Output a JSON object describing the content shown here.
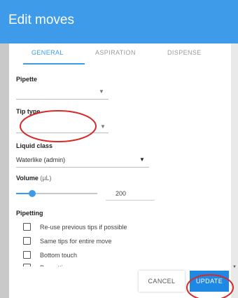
{
  "dialog": {
    "title": "Edit moves"
  },
  "tabs": [
    {
      "label": "GENERAL",
      "active": true
    },
    {
      "label": "ASPIRATION",
      "active": false
    },
    {
      "label": "DISPENSE",
      "active": false
    }
  ],
  "fields": {
    "pipette": {
      "label": "Pipette",
      "value": ""
    },
    "tip_type": {
      "label": "Tip type",
      "value": ""
    },
    "liquid_class": {
      "label": "Liquid class",
      "value": "Waterlike (admin)"
    },
    "volume": {
      "label": "Volume",
      "unit": "(µL)",
      "value": "200",
      "slider_fraction": 0.2
    }
  },
  "pipetting": {
    "label": "Pipetting",
    "options": [
      {
        "label": "Re-use previous tips if possible",
        "checked": false
      },
      {
        "label": "Same tips for entire move",
        "checked": false
      },
      {
        "label": "Bottom touch",
        "checked": false
      },
      {
        "label": "Prewetting",
        "checked": false
      }
    ]
  },
  "buttons": {
    "cancel": "CANCEL",
    "update": "UPDATE"
  },
  "icons": {
    "dropdown": "chevron-down-icon",
    "scroll": "scroll-down-icon"
  },
  "colors": {
    "accent": "#3d9be9",
    "annotation": "#d62a2a"
  }
}
